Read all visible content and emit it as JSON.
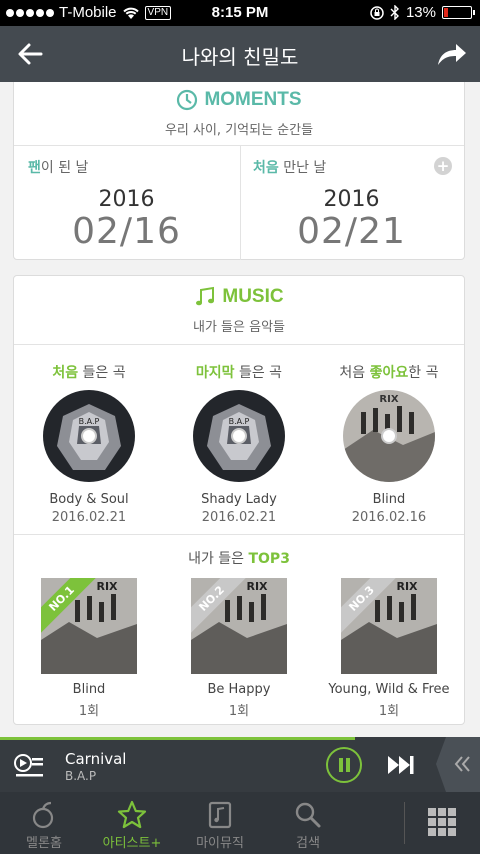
{
  "status_bar": {
    "carrier": "T-Mobile",
    "vpn": "VPN",
    "time": "8:15 PM",
    "battery": "13%"
  },
  "header": {
    "title": "나와의 친밀도"
  },
  "moments": {
    "title": "MOMENTS",
    "subtitle": "우리 사이, 기억되는 순간들",
    "fan_label_hl": "팬",
    "fan_label_rest": "이 된 날",
    "fan_year": "2016",
    "fan_md": "02/16",
    "met_label_hl": "처음",
    "met_label_rest": " 만난 날",
    "met_year": "2016",
    "met_md": "02/21"
  },
  "music": {
    "title": "MUSIC",
    "subtitle": "내가 들은 음악들",
    "first": {
      "label_hl": "처음",
      "label_rest": " 들은 곡",
      "name": "Body & Soul",
      "date": "2016.02.21"
    },
    "last": {
      "label_hl": "마지막",
      "label_rest": " 들은 곡",
      "name": "Shady Lady",
      "date": "2016.02.21"
    },
    "liked": {
      "label_pre": "처음 ",
      "label_hl": "좋아요",
      "label_rest": "한 곡",
      "name": "Blind",
      "date": "2016.02.16"
    },
    "top3_pre": "내가 들은 ",
    "top3_hl": "TOP3",
    "top3": [
      {
        "rank": "NO.1",
        "name": "Blind",
        "count": "1회"
      },
      {
        "rank": "NO.2",
        "name": "Be Happy",
        "count": "1회"
      },
      {
        "rank": "NO.3",
        "name": "Young, Wild & Free",
        "count": "1회"
      }
    ],
    "album_text": "B.A.P",
    "album_text2": "RIX"
  },
  "player": {
    "title": "Carnival",
    "artist": "B.A.P",
    "progress": 0.74
  },
  "tabs": [
    "멜론홈",
    "아티스트+",
    "마이뮤직",
    "검색"
  ],
  "colors": {
    "accent_green": "#7dc23b",
    "moments_teal": "#5ab9a8",
    "header": "#444a50"
  }
}
